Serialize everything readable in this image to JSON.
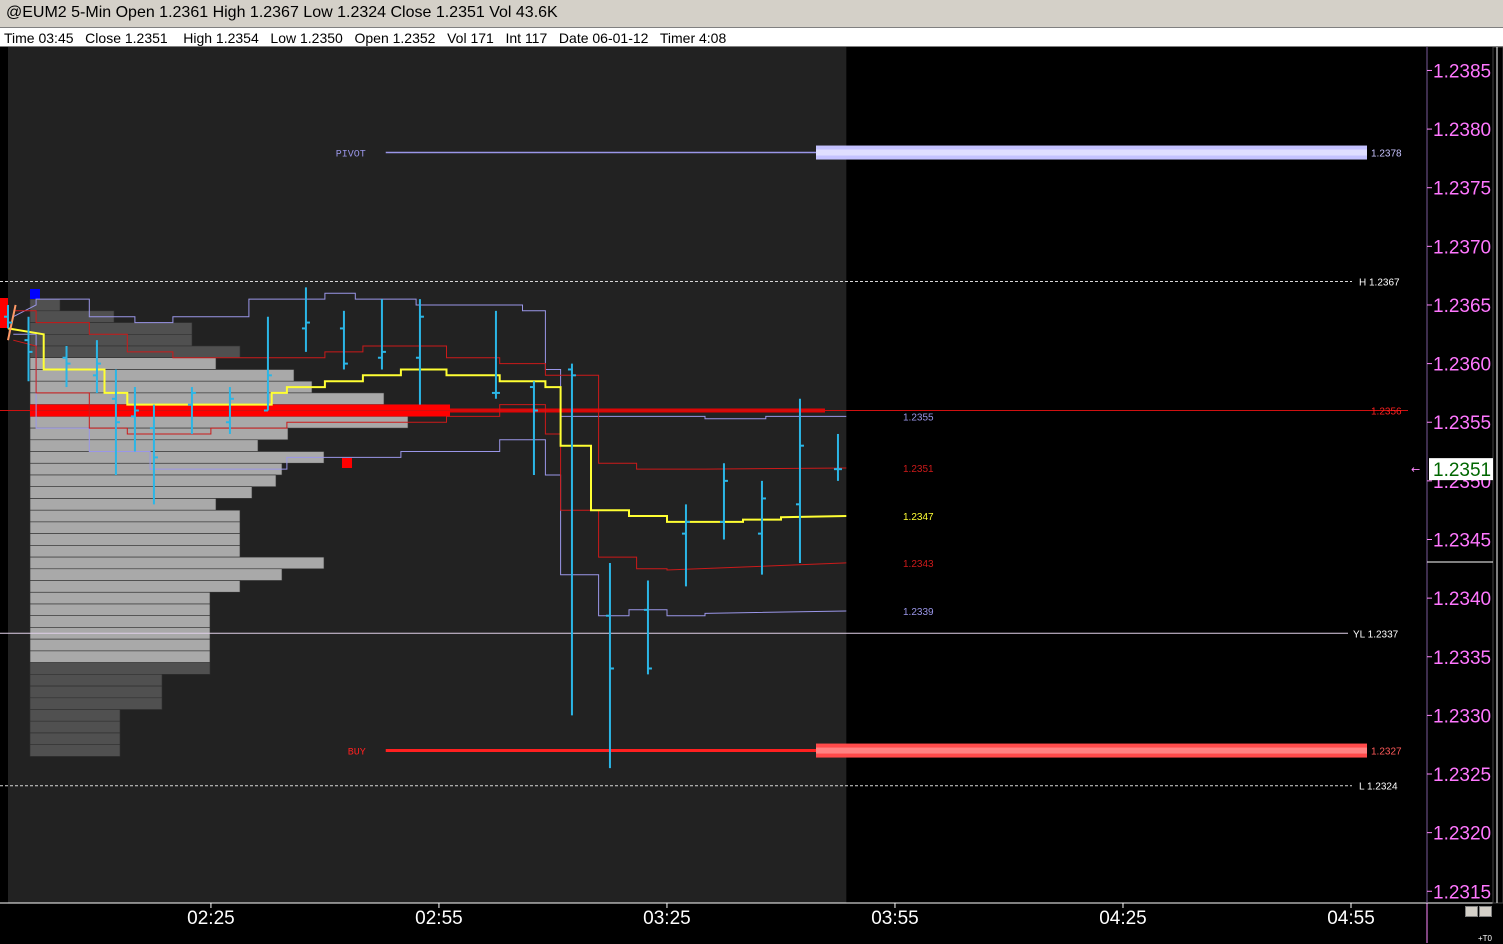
{
  "window": {
    "title": "@EUM2 5-Min Open 1.2361 High 1.2367 Low 1.2324 Close 1.2351 Vol 43.6K",
    "status": "Time 03:45   Close 1.2351    High 1.2354   Low 1.2350   Open 1.2352   Vol 171   Int 117   Date 06-01-12   Timer 4:08"
  },
  "colors": {
    "background": "#000000",
    "session_shade": "#222222",
    "bars": "#2bb6e6",
    "vwap": "#ffff33",
    "band_red": "#cc1a1a",
    "band_blue": "#9a96e8",
    "profile_light": "#a9a9a9",
    "profile_dark": "#505050",
    "poc": "#ff0000",
    "axis_text": "#ff77ff",
    "current_price_bg": "#ffffff",
    "current_price_text": "#006600"
  },
  "chart_data": {
    "type": "candlestick",
    "symbol": "@EUM2",
    "interval": "5-Min",
    "ylim": [
      1.2314,
      1.2387
    ],
    "y_ticks": [
      "1.2385",
      "1.2380",
      "1.2375",
      "1.2370",
      "1.2365",
      "1.2360",
      "1.2355",
      "1.2350",
      "1.2345",
      "1.2340",
      "1.2335",
      "1.2330",
      "1.2325",
      "1.2320",
      "1.2315"
    ],
    "x_ticks": [
      "02:25",
      "02:55",
      "03:25",
      "03:55",
      "04:25",
      "04:55"
    ],
    "x_tick_values": [
      145,
      175,
      205,
      235,
      265,
      295
    ],
    "xlim": [
      118.3,
      305
    ],
    "session_end": 228.6,
    "ohlc": [
      {
        "t": 118.3,
        "o": 1.2364,
        "h": 1.2365,
        "l": 1.2363,
        "c": 1.23635
      },
      {
        "t": 121,
        "o": 1.2362,
        "h": 1.2364,
        "l": 1.23585,
        "c": 1.2361
      },
      {
        "t": 126,
        "o": 1.23605,
        "h": 1.23615,
        "l": 1.2358,
        "c": 1.236
      },
      {
        "t": 130,
        "o": 1.2359,
        "h": 1.2362,
        "l": 1.23575,
        "c": 1.236
      },
      {
        "t": 132.5,
        "o": 1.2357,
        "h": 1.23595,
        "l": 1.23505,
        "c": 1.2355
      },
      {
        "t": 135,
        "o": 1.23555,
        "h": 1.2358,
        "l": 1.23525,
        "c": 1.2356
      },
      {
        "t": 137.5,
        "o": 1.23545,
        "h": 1.23565,
        "l": 1.2348,
        "c": 1.2352
      },
      {
        "t": 142.5,
        "o": 1.23565,
        "h": 1.2358,
        "l": 1.2354,
        "c": 1.23575
      },
      {
        "t": 147.5,
        "o": 1.2355,
        "h": 1.2358,
        "l": 1.2354,
        "c": 1.2357
      },
      {
        "t": 152.5,
        "o": 1.2356,
        "h": 1.2364,
        "l": 1.2356,
        "c": 1.2359
      },
      {
        "t": 157.5,
        "o": 1.2363,
        "h": 1.23665,
        "l": 1.2361,
        "c": 1.23635
      },
      {
        "t": 162.5,
        "o": 1.2363,
        "h": 1.23645,
        "l": 1.23595,
        "c": 1.236
      },
      {
        "t": 167.5,
        "o": 1.23605,
        "h": 1.23655,
        "l": 1.23595,
        "c": 1.2361
      },
      {
        "t": 172.5,
        "o": 1.23605,
        "h": 1.23655,
        "l": 1.23565,
        "c": 1.2364
      },
      {
        "t": 182.5,
        "o": 1.23575,
        "h": 1.23645,
        "l": 1.2357,
        "c": 1.23575
      },
      {
        "t": 187.5,
        "o": 1.2358,
        "h": 1.23585,
        "l": 1.23505,
        "c": 1.2356
      },
      {
        "t": 192.5,
        "o": 1.23595,
        "h": 1.236,
        "l": 1.233,
        "c": 1.2359
      },
      {
        "t": 197.5,
        "o": 1.23385,
        "h": 1.2343,
        "l": 1.23255,
        "c": 1.2334
      },
      {
        "t": 202.5,
        "o": 1.2339,
        "h": 1.23415,
        "l": 1.23335,
        "c": 1.2334
      },
      {
        "t": 207.5,
        "o": 1.23455,
        "h": 1.2348,
        "l": 1.2341,
        "c": 1.23465
      },
      {
        "t": 212.5,
        "o": 1.23465,
        "h": 1.23515,
        "l": 1.2345,
        "c": 1.235
      },
      {
        "t": 217.5,
        "o": 1.23455,
        "h": 1.235,
        "l": 1.2342,
        "c": 1.23485
      },
      {
        "t": 222.5,
        "o": 1.2348,
        "h": 1.2357,
        "l": 1.2343,
        "c": 1.2353
      },
      {
        "t": 227.5,
        "o": 1.2351,
        "h": 1.2354,
        "l": 1.235,
        "c": 1.2351
      }
    ],
    "vwap": [
      [
        118.3,
        1.2363
      ],
      [
        123,
        1.23625
      ],
      [
        123,
        1.23595
      ],
      [
        131,
        1.23595
      ],
      [
        131,
        1.23575
      ],
      [
        134,
        1.23575
      ],
      [
        134,
        1.23565
      ],
      [
        153,
        1.23565
      ],
      [
        153,
        1.23575
      ],
      [
        155,
        1.23575
      ],
      [
        155,
        1.2358
      ],
      [
        160,
        1.2358
      ],
      [
        160,
        1.23585
      ],
      [
        165,
        1.23585
      ],
      [
        165,
        1.2359
      ],
      [
        170,
        1.2359
      ],
      [
        170,
        1.23595
      ],
      [
        176,
        1.23595
      ],
      [
        176,
        1.2359
      ],
      [
        183,
        1.2359
      ],
      [
        183,
        1.23585
      ],
      [
        189,
        1.23585
      ],
      [
        189,
        1.2358
      ],
      [
        191,
        1.2358
      ],
      [
        191,
        1.2353
      ],
      [
        195,
        1.2353
      ],
      [
        195,
        1.23475
      ],
      [
        200,
        1.23475
      ],
      [
        200,
        1.2347
      ],
      [
        205,
        1.2347
      ],
      [
        205,
        1.23465
      ],
      [
        210,
        1.23465
      ],
      [
        210,
        1.23465
      ],
      [
        215,
        1.23465
      ],
      [
        215,
        1.23467
      ],
      [
        220,
        1.23467
      ],
      [
        220,
        1.23469
      ],
      [
        228.6,
        1.2347
      ]
    ],
    "band_upper_red": [
      [
        119,
        1.23645
      ],
      [
        122,
        1.23645
      ],
      [
        122,
        1.23635
      ],
      [
        129,
        1.23635
      ],
      [
        129,
        1.23625
      ],
      [
        134,
        1.23625
      ],
      [
        134,
        1.2361
      ],
      [
        140,
        1.2361
      ],
      [
        140,
        1.23605
      ],
      [
        160,
        1.23605
      ],
      [
        160,
        1.2361
      ],
      [
        165,
        1.2361
      ],
      [
        165,
        1.23615
      ],
      [
        176,
        1.23615
      ],
      [
        176,
        1.23605
      ],
      [
        183,
        1.23605
      ],
      [
        183,
        1.236
      ],
      [
        189,
        1.236
      ],
      [
        189,
        1.2359
      ],
      [
        196,
        1.2359
      ],
      [
        196,
        1.23515
      ],
      [
        201,
        1.23515
      ],
      [
        201,
        1.2351
      ],
      [
        210,
        1.2351
      ],
      [
        210,
        1.2351
      ],
      [
        228.6,
        1.23511
      ]
    ],
    "band_lower_red": [
      [
        119,
        1.2362
      ],
      [
        122,
        1.23615
      ],
      [
        122,
        1.23575
      ],
      [
        129,
        1.23575
      ],
      [
        129,
        1.23545
      ],
      [
        134,
        1.23545
      ],
      [
        134,
        1.2354
      ],
      [
        145,
        1.2354
      ],
      [
        145,
        1.23545
      ],
      [
        155,
        1.23545
      ],
      [
        155,
        1.2355
      ],
      [
        176,
        1.2355
      ],
      [
        176,
        1.23555
      ],
      [
        183,
        1.23555
      ],
      [
        183,
        1.23565
      ],
      [
        189,
        1.23565
      ],
      [
        189,
        1.2354
      ],
      [
        191,
        1.2354
      ],
      [
        191,
        1.23475
      ],
      [
        196,
        1.23475
      ],
      [
        196,
        1.23435
      ],
      [
        201,
        1.23435
      ],
      [
        201,
        1.23425
      ],
      [
        205,
        1.23425
      ],
      [
        205,
        1.23424
      ],
      [
        228.6,
        1.2343
      ]
    ],
    "band_upper_blue": [
      [
        119,
        1.2364
      ],
      [
        122,
        1.2365
      ],
      [
        122,
        1.23655
      ],
      [
        129,
        1.23655
      ],
      [
        129,
        1.2364
      ],
      [
        135,
        1.2364
      ],
      [
        135,
        1.23635
      ],
      [
        140,
        1.23635
      ],
      [
        140,
        1.2364
      ],
      [
        150,
        1.2364
      ],
      [
        150,
        1.23655
      ],
      [
        160,
        1.23655
      ],
      [
        160,
        1.2366
      ],
      [
        164,
        1.2366
      ],
      [
        164,
        1.23655
      ],
      [
        172,
        1.23655
      ],
      [
        172,
        1.2365
      ],
      [
        186,
        1.2365
      ],
      [
        186,
        1.23645
      ],
      [
        189,
        1.23645
      ],
      [
        189,
        1.23595
      ],
      [
        191,
        1.23595
      ],
      [
        191,
        1.23555
      ],
      [
        200,
        1.23555
      ],
      [
        200,
        1.23555
      ],
      [
        210,
        1.23555
      ],
      [
        210,
        1.23553
      ],
      [
        218,
        1.23553
      ],
      [
        218,
        1.23555
      ],
      [
        228.6,
        1.23555
      ]
    ],
    "band_lower_blue": [
      [
        119,
        1.23625
      ],
      [
        122,
        1.23625
      ],
      [
        122,
        1.23545
      ],
      [
        129,
        1.23545
      ],
      [
        129,
        1.23525
      ],
      [
        137,
        1.23525
      ],
      [
        137,
        1.2351
      ],
      [
        155,
        1.2351
      ],
      [
        155,
        1.2352
      ],
      [
        170,
        1.2352
      ],
      [
        170,
        1.23525
      ],
      [
        183,
        1.23525
      ],
      [
        183,
        1.23535
      ],
      [
        189,
        1.23535
      ],
      [
        189,
        1.23505
      ],
      [
        191,
        1.23505
      ],
      [
        191,
        1.2342
      ],
      [
        196,
        1.2342
      ],
      [
        196,
        1.23385
      ],
      [
        200,
        1.23385
      ],
      [
        200,
        1.2339
      ],
      [
        205,
        1.2339
      ],
      [
        205,
        1.23385
      ],
      [
        210,
        1.23385
      ],
      [
        210,
        1.23387
      ],
      [
        228.6,
        1.23389
      ]
    ],
    "value_area": {
      "high": 1.2365,
      "low": 1.2335
    },
    "volume_profile": [
      [
        1.2365,
        5,
        1
      ],
      [
        1.2364,
        14,
        1
      ],
      [
        1.2363,
        27,
        1
      ],
      [
        1.2362,
        27,
        1
      ],
      [
        1.2361,
        35,
        1
      ],
      [
        1.236,
        31,
        0
      ],
      [
        1.2359,
        44,
        0
      ],
      [
        1.2358,
        47,
        0
      ],
      [
        1.2357,
        59,
        0
      ],
      [
        1.2356,
        66,
        0
      ],
      [
        1.2355,
        63,
        0
      ],
      [
        1.2354,
        43,
        0
      ],
      [
        1.2353,
        38,
        0
      ],
      [
        1.2352,
        49,
        0
      ],
      [
        1.2351,
        42,
        0
      ],
      [
        1.235,
        41,
        0
      ],
      [
        1.2349,
        37,
        0
      ],
      [
        1.2348,
        31,
        0
      ],
      [
        1.2347,
        35,
        0
      ],
      [
        1.2346,
        35,
        0
      ],
      [
        1.2345,
        35,
        0
      ],
      [
        1.2344,
        35,
        0
      ],
      [
        1.2343,
        49,
        0
      ],
      [
        1.2342,
        42,
        0
      ],
      [
        1.2341,
        35,
        0
      ],
      [
        1.234,
        30,
        0
      ],
      [
        1.2339,
        30,
        0
      ],
      [
        1.2338,
        30,
        0
      ],
      [
        1.2337,
        30,
        0
      ],
      [
        1.2336,
        30,
        0
      ],
      [
        1.2335,
        30,
        0
      ],
      [
        1.2334,
        30,
        1
      ],
      [
        1.2333,
        22,
        1
      ],
      [
        1.2332,
        22,
        1
      ],
      [
        1.2331,
        22,
        1
      ],
      [
        1.233,
        15,
        1
      ],
      [
        1.2329,
        15,
        1
      ],
      [
        1.2328,
        15,
        1
      ],
      [
        1.2327,
        15,
        1
      ]
    ],
    "poc": 1.2356,
    "levels": [
      {
        "name": "PIVOT",
        "price": 1.2378,
        "style": "pivot",
        "label": "1.2378",
        "left_label": "PIVOT",
        "start": 168
      },
      {
        "name": "H",
        "price": 1.2367,
        "style": "dashed",
        "label": "H  1.2367"
      },
      {
        "name": "POC",
        "price": 1.2356,
        "style": "red",
        "label": "1.2356"
      },
      {
        "name": "YL",
        "price": 1.2337,
        "style": "solid",
        "label": "YL  1.2337"
      },
      {
        "name": "BUY",
        "price": 1.2327,
        "style": "buy",
        "label": "1.2327",
        "left_label": "BUY",
        "start": 168
      },
      {
        "name": "L",
        "price": 1.2324,
        "style": "dashed",
        "label": "L  1.2324"
      }
    ],
    "band_labels": [
      {
        "label": "1.2355",
        "price": 1.23555,
        "color": "#9a96e8"
      },
      {
        "label": "1.2351",
        "price": 1.23511,
        "color": "#cc1a1a"
      },
      {
        "label": "1.2347",
        "price": 1.2347,
        "color": "#ffff33"
      },
      {
        "label": "1.2343",
        "price": 1.2343,
        "color": "#cc1a1a"
      },
      {
        "label": "1.2339",
        "price": 1.23389,
        "color": "#9a96e8"
      }
    ],
    "current_price": "1.2351",
    "current_price_value": 1.2351,
    "corner_label": "+T0"
  }
}
